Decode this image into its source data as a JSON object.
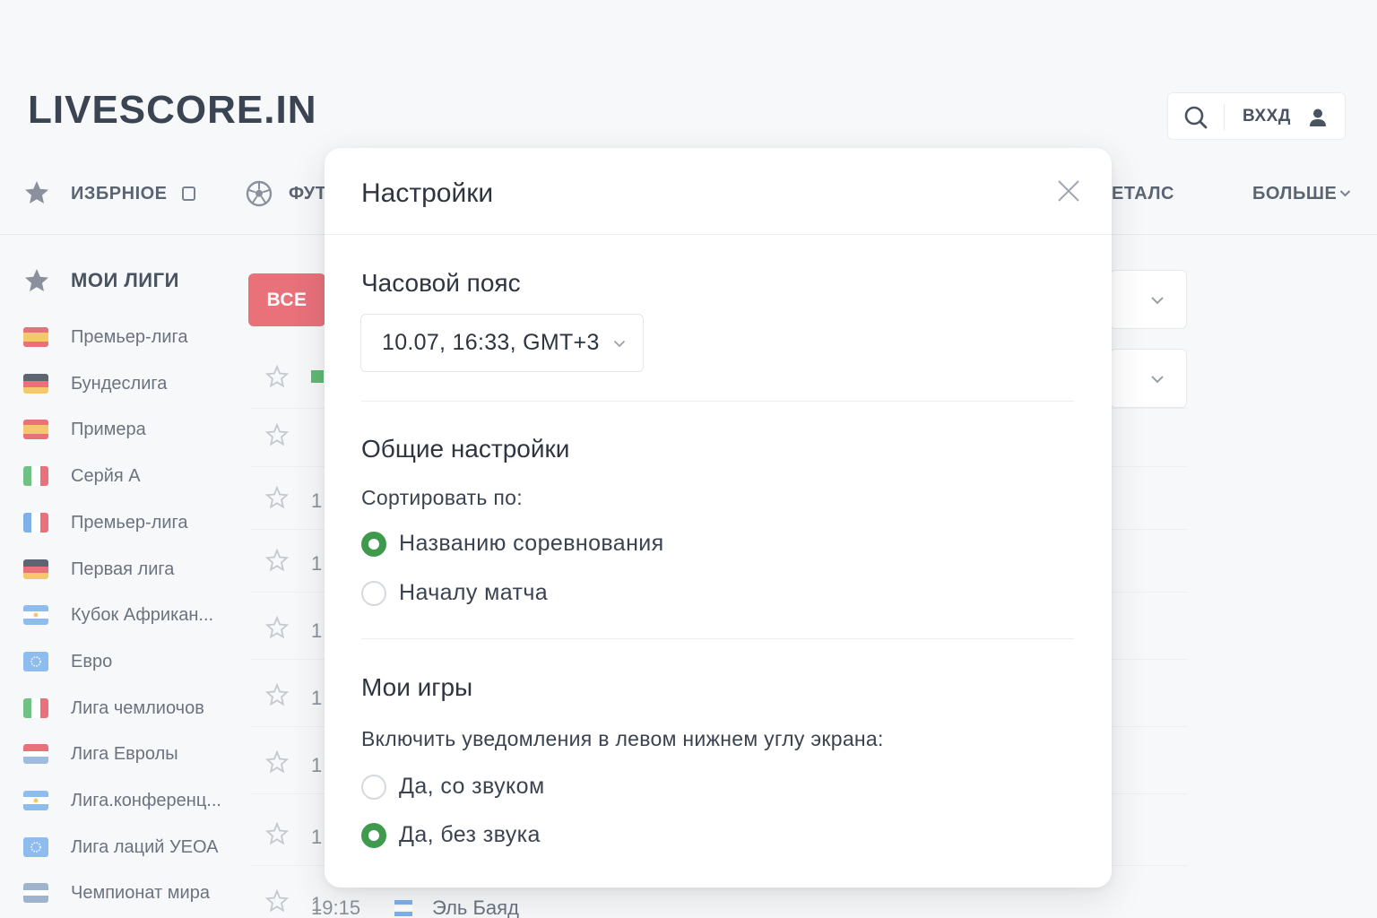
{
  "header": {
    "logo": "LIVESCORE.IN",
    "login_label": "ВХХД"
  },
  "nav": {
    "favorites": "ИЗБРНІОЕ",
    "football": "ФУТ",
    "details": "ЕТАЛС",
    "more": "БОЛЬШЕ"
  },
  "sidebar": {
    "title": "МОИ ЛИГИ",
    "leagues": [
      {
        "name": "Премьер-лига",
        "flag": "spain"
      },
      {
        "name": "Бундеслига",
        "flag": "germany"
      },
      {
        "name": "Примера",
        "flag": "spain"
      },
      {
        "name": "Серйя А",
        "flag": "italy"
      },
      {
        "name": "Премьер-лига",
        "flag": "france"
      },
      {
        "name": "Первая лига",
        "flag": "germany"
      },
      {
        "name": "Кубок Африкан...",
        "flag": "argentina"
      },
      {
        "name": "Евро",
        "flag": "eu"
      },
      {
        "name": "Лига чемлиочов",
        "flag": "italy"
      },
      {
        "name": "Лига Евролы",
        "flag": "red-blue"
      },
      {
        "name": "Лига.конференц...",
        "flag": "argentina"
      },
      {
        "name": "Лига лаций УЕОА",
        "flag": "eu"
      },
      {
        "name": "Чемпионат мира",
        "flag": "blue-grey"
      }
    ]
  },
  "content": {
    "all_button": "ВСЕ",
    "row_times": [
      "1",
      "1",
      "1",
      "1",
      "1",
      "1",
      "1"
    ],
    "bottom_row": {
      "time": "19:15",
      "team": "Эль Баяд"
    }
  },
  "modal": {
    "title": "Настройки",
    "timezone": {
      "title": "Часовой пояс",
      "value": "10.07, 16:33, GMT+3"
    },
    "general": {
      "title": "Общие настройки",
      "sort_label": "Сортировать по:",
      "options": [
        {
          "label": "Названию соревнования",
          "selected": true
        },
        {
          "label": "Началу матча",
          "selected": false
        }
      ]
    },
    "my_games": {
      "title": "Мои игры",
      "notify_label": "Включить уведомления в левом нижнем углу экрана:",
      "options": [
        {
          "label": "Да, со звуком",
          "selected": false
        },
        {
          "label": "Да, без звука",
          "selected": true
        }
      ]
    }
  },
  "colors": {
    "accent_green": "#3f9a4e",
    "all_button": "#e8717a",
    "text_dark": "#2e3540"
  },
  "icons": [
    "search-icon",
    "user-icon",
    "star-icon",
    "soccer-ball-icon",
    "close-icon",
    "chevron-down-icon"
  ]
}
